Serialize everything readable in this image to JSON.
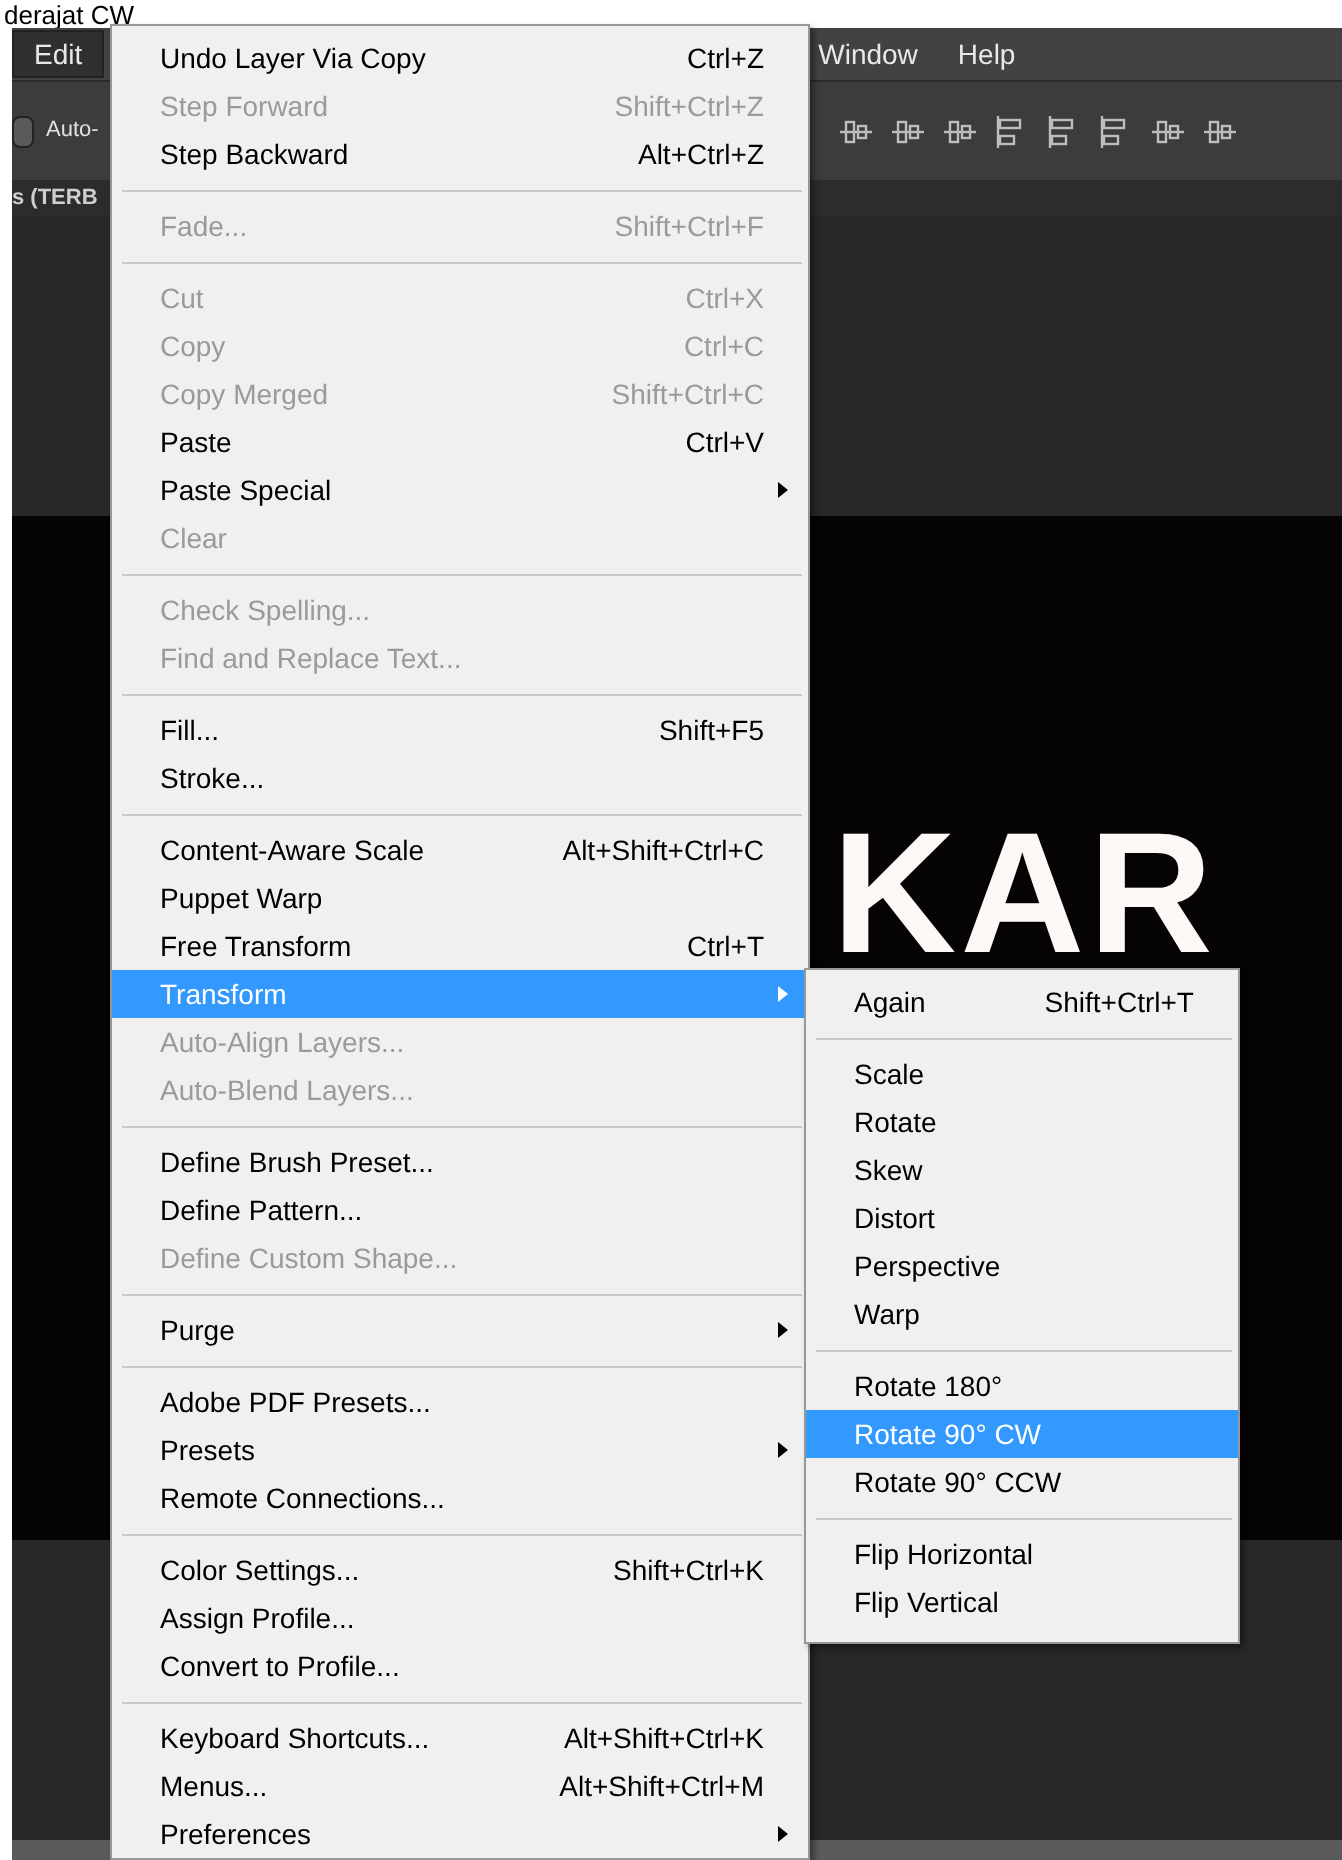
{
  "caption": "derajat CW",
  "menubar": [
    {
      "label": "Edit",
      "selected": true
    },
    {
      "label": "Window",
      "selected": false
    },
    {
      "label": "Help",
      "selected": false
    }
  ],
  "toolbar": {
    "checkbox": {
      "label": "Auto-",
      "checked": false
    }
  },
  "document_tab": "s (TERB",
  "canvas_text": "KAR",
  "edit_menu": [
    {
      "kind": "item",
      "label": "Undo Layer Via Copy",
      "shortcut": "Ctrl+Z",
      "disabled": false,
      "selected": false,
      "submenu": false
    },
    {
      "kind": "item",
      "label": "Step Forward",
      "shortcut": "Shift+Ctrl+Z",
      "disabled": true,
      "selected": false,
      "submenu": false
    },
    {
      "kind": "item",
      "label": "Step Backward",
      "shortcut": "Alt+Ctrl+Z",
      "disabled": false,
      "selected": false,
      "submenu": false
    },
    {
      "kind": "separator"
    },
    {
      "kind": "item",
      "label": "Fade...",
      "shortcut": "Shift+Ctrl+F",
      "disabled": true,
      "selected": false,
      "submenu": false
    },
    {
      "kind": "separator"
    },
    {
      "kind": "item",
      "label": "Cut",
      "shortcut": "Ctrl+X",
      "disabled": true,
      "selected": false,
      "submenu": false
    },
    {
      "kind": "item",
      "label": "Copy",
      "shortcut": "Ctrl+C",
      "disabled": true,
      "selected": false,
      "submenu": false
    },
    {
      "kind": "item",
      "label": "Copy Merged",
      "shortcut": "Shift+Ctrl+C",
      "disabled": true,
      "selected": false,
      "submenu": false
    },
    {
      "kind": "item",
      "label": "Paste",
      "shortcut": "Ctrl+V",
      "disabled": false,
      "selected": false,
      "submenu": false
    },
    {
      "kind": "item",
      "label": "Paste Special",
      "disabled": false,
      "selected": false,
      "submenu": true
    },
    {
      "kind": "item",
      "label": "Clear",
      "disabled": true,
      "selected": false,
      "submenu": false
    },
    {
      "kind": "separator"
    },
    {
      "kind": "item",
      "label": "Check Spelling...",
      "disabled": true,
      "selected": false,
      "submenu": false
    },
    {
      "kind": "item",
      "label": "Find and Replace Text...",
      "disabled": true,
      "selected": false,
      "submenu": false
    },
    {
      "kind": "separator"
    },
    {
      "kind": "item",
      "label": "Fill...",
      "shortcut": "Shift+F5",
      "disabled": false,
      "selected": false,
      "submenu": false
    },
    {
      "kind": "item",
      "label": "Stroke...",
      "disabled": false,
      "selected": false,
      "submenu": false
    },
    {
      "kind": "separator"
    },
    {
      "kind": "item",
      "label": "Content-Aware Scale",
      "shortcut": "Alt+Shift+Ctrl+C",
      "disabled": false,
      "selected": false,
      "submenu": false
    },
    {
      "kind": "item",
      "label": "Puppet Warp",
      "disabled": false,
      "selected": false,
      "submenu": false
    },
    {
      "kind": "item",
      "label": "Free Transform",
      "shortcut": "Ctrl+T",
      "disabled": false,
      "selected": false,
      "submenu": false
    },
    {
      "kind": "item",
      "label": "Transform",
      "disabled": false,
      "selected": true,
      "submenu": true
    },
    {
      "kind": "item",
      "label": "Auto-Align Layers...",
      "disabled": true,
      "selected": false,
      "submenu": false
    },
    {
      "kind": "item",
      "label": "Auto-Blend Layers...",
      "disabled": true,
      "selected": false,
      "submenu": false
    },
    {
      "kind": "separator"
    },
    {
      "kind": "item",
      "label": "Define Brush Preset...",
      "disabled": false,
      "selected": false,
      "submenu": false
    },
    {
      "kind": "item",
      "label": "Define Pattern...",
      "disabled": false,
      "selected": false,
      "submenu": false
    },
    {
      "kind": "item",
      "label": "Define Custom Shape...",
      "disabled": true,
      "selected": false,
      "submenu": false
    },
    {
      "kind": "separator"
    },
    {
      "kind": "item",
      "label": "Purge",
      "disabled": false,
      "selected": false,
      "submenu": true
    },
    {
      "kind": "separator"
    },
    {
      "kind": "item",
      "label": "Adobe PDF Presets...",
      "disabled": false,
      "selected": false,
      "submenu": false
    },
    {
      "kind": "item",
      "label": "Presets",
      "disabled": false,
      "selected": false,
      "submenu": true
    },
    {
      "kind": "item",
      "label": "Remote Connections...",
      "disabled": false,
      "selected": false,
      "submenu": false
    },
    {
      "kind": "separator"
    },
    {
      "kind": "item",
      "label": "Color Settings...",
      "shortcut": "Shift+Ctrl+K",
      "disabled": false,
      "selected": false,
      "submenu": false
    },
    {
      "kind": "item",
      "label": "Assign Profile...",
      "disabled": false,
      "selected": false,
      "submenu": false
    },
    {
      "kind": "item",
      "label": "Convert to Profile...",
      "disabled": false,
      "selected": false,
      "submenu": false
    },
    {
      "kind": "separator"
    },
    {
      "kind": "item",
      "label": "Keyboard Shortcuts...",
      "shortcut": "Alt+Shift+Ctrl+K",
      "disabled": false,
      "selected": false,
      "submenu": false
    },
    {
      "kind": "item",
      "label": "Menus...",
      "shortcut": "Alt+Shift+Ctrl+M",
      "disabled": false,
      "selected": false,
      "submenu": false
    },
    {
      "kind": "item",
      "label": "Preferences",
      "disabled": false,
      "selected": false,
      "submenu": true
    }
  ],
  "transform_submenu": [
    {
      "kind": "item",
      "label": "Again",
      "shortcut": "Shift+Ctrl+T",
      "disabled": false,
      "selected": false,
      "submenu": false
    },
    {
      "kind": "separator"
    },
    {
      "kind": "item",
      "label": "Scale",
      "disabled": false,
      "selected": false,
      "submenu": false
    },
    {
      "kind": "item",
      "label": "Rotate",
      "disabled": false,
      "selected": false,
      "submenu": false
    },
    {
      "kind": "item",
      "label": "Skew",
      "disabled": false,
      "selected": false,
      "submenu": false
    },
    {
      "kind": "item",
      "label": "Distort",
      "disabled": false,
      "selected": false,
      "submenu": false
    },
    {
      "kind": "item",
      "label": "Perspective",
      "disabled": false,
      "selected": false,
      "submenu": false
    },
    {
      "kind": "item",
      "label": "Warp",
      "disabled": false,
      "selected": false,
      "submenu": false
    },
    {
      "kind": "separator"
    },
    {
      "kind": "item",
      "label": "Rotate 180°",
      "disabled": false,
      "selected": false,
      "submenu": false
    },
    {
      "kind": "item",
      "label": "Rotate 90° CW",
      "disabled": false,
      "selected": true,
      "submenu": false
    },
    {
      "kind": "item",
      "label": "Rotate 90° CCW",
      "disabled": false,
      "selected": false,
      "submenu": false
    },
    {
      "kind": "separator"
    },
    {
      "kind": "item",
      "label": "Flip Horizontal",
      "disabled": false,
      "selected": false,
      "submenu": false
    },
    {
      "kind": "item",
      "label": "Flip Vertical",
      "disabled": false,
      "selected": false,
      "submenu": false
    }
  ]
}
